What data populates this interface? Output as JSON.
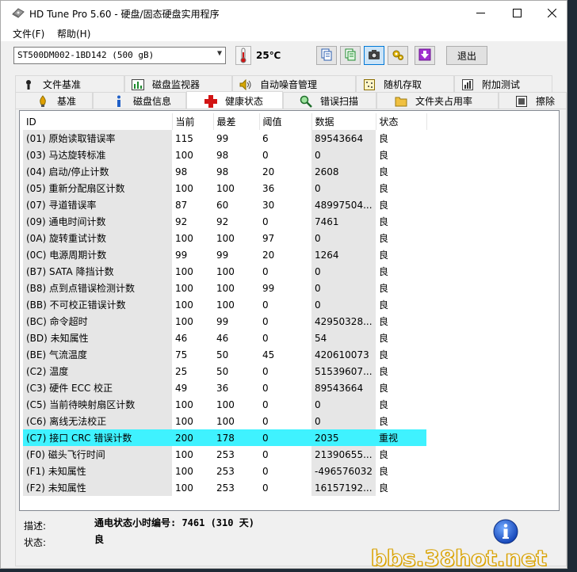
{
  "window": {
    "title": "HD Tune Pro 5.60 - 硬盘/固态硬盘实用程序"
  },
  "menu": {
    "file": "文件(F)",
    "help": "帮助(H)"
  },
  "toolbar": {
    "drive": "ST500DM002-1BD142 (500 gB)",
    "temperature": "25℃",
    "exit_label": "退出"
  },
  "tabs_top": [
    {
      "label": "文件基准",
      "icon": "file-benchmark-icon"
    },
    {
      "label": "磁盘监视器",
      "icon": "disk-monitor-icon"
    },
    {
      "label": "自动噪音管理",
      "icon": "speaker-icon"
    },
    {
      "label": "随机存取",
      "icon": "random-access-icon"
    },
    {
      "label": "附加测试",
      "icon": "extra-tests-icon"
    }
  ],
  "tabs_bottom": [
    {
      "label": "基准",
      "icon": "benchmark-icon"
    },
    {
      "label": "磁盘信息",
      "icon": "info-icon"
    },
    {
      "label": "健康状态",
      "icon": "health-cross-icon"
    },
    {
      "label": "错误扫描",
      "icon": "magnifier-icon"
    },
    {
      "label": "文件夹占用率",
      "icon": "folder-icon"
    },
    {
      "label": "擦除",
      "icon": "erase-icon"
    }
  ],
  "table": {
    "headers": [
      "ID",
      "当前",
      "最差",
      "阈值",
      "数据",
      "状态"
    ],
    "rows": [
      [
        "(01) 原始读取错误率",
        "115",
        "99",
        "6",
        "89543664",
        "良"
      ],
      [
        "(03) 马达旋转标准",
        "100",
        "98",
        "0",
        "0",
        "良"
      ],
      [
        "(04) 启动/停止计数",
        "98",
        "98",
        "20",
        "2608",
        "良"
      ],
      [
        "(05) 重新分配扇区计数",
        "100",
        "100",
        "36",
        "0",
        "良"
      ],
      [
        "(07) 寻道错误率",
        "87",
        "60",
        "30",
        "48997504...",
        "良"
      ],
      [
        "(09) 通电时间计数",
        "92",
        "92",
        "0",
        "7461",
        "良"
      ],
      [
        "(0A) 旋转重试计数",
        "100",
        "100",
        "97",
        "0",
        "良"
      ],
      [
        "(0C) 电源周期计数",
        "99",
        "99",
        "20",
        "1264",
        "良"
      ],
      [
        "(B7) SATA 降挡计数",
        "100",
        "100",
        "0",
        "0",
        "良"
      ],
      [
        "(B8) 点到点错误检测计数",
        "100",
        "100",
        "99",
        "0",
        "良"
      ],
      [
        "(BB) 不可校正错误计数",
        "100",
        "100",
        "0",
        "0",
        "良"
      ],
      [
        "(BC) 命令超时",
        "100",
        "99",
        "0",
        "42950328...",
        "良"
      ],
      [
        "(BD) 未知属性",
        "46",
        "46",
        "0",
        "54",
        "良"
      ],
      [
        "(BE) 气流温度",
        "75",
        "50",
        "45",
        "420610073",
        "良"
      ],
      [
        "(C2) 温度",
        "25",
        "50",
        "0",
        "51539607...",
        "良"
      ],
      [
        "(C3) 硬件 ECC 校正",
        "49",
        "36",
        "0",
        "89543664",
        "良"
      ],
      [
        "(C5) 当前待映射扇区计数",
        "100",
        "100",
        "0",
        "0",
        "良"
      ],
      [
        "(C6) 离线无法校正",
        "100",
        "100",
        "0",
        "0",
        "良"
      ],
      [
        "(C7) 接口 CRC 错误计数",
        "200",
        "178",
        "0",
        "2035",
        "重视"
      ],
      [
        "(F0) 磁头飞行时间",
        "100",
        "253",
        "0",
        "21390655...",
        "良"
      ],
      [
        "(F1) 未知属性",
        "100",
        "253",
        "0",
        "-496576032",
        "良"
      ],
      [
        "(F2) 未知属性",
        "100",
        "253",
        "0",
        "16157192...",
        "良"
      ]
    ],
    "warning_row_color": "#3ff2ff"
  },
  "details": {
    "desc_label": "描述:",
    "desc_value": "通电状态小时编号: 7461 (310 天)",
    "status_label": "状态:",
    "status_value": "良"
  },
  "watermark": "bbs.38hot.net"
}
